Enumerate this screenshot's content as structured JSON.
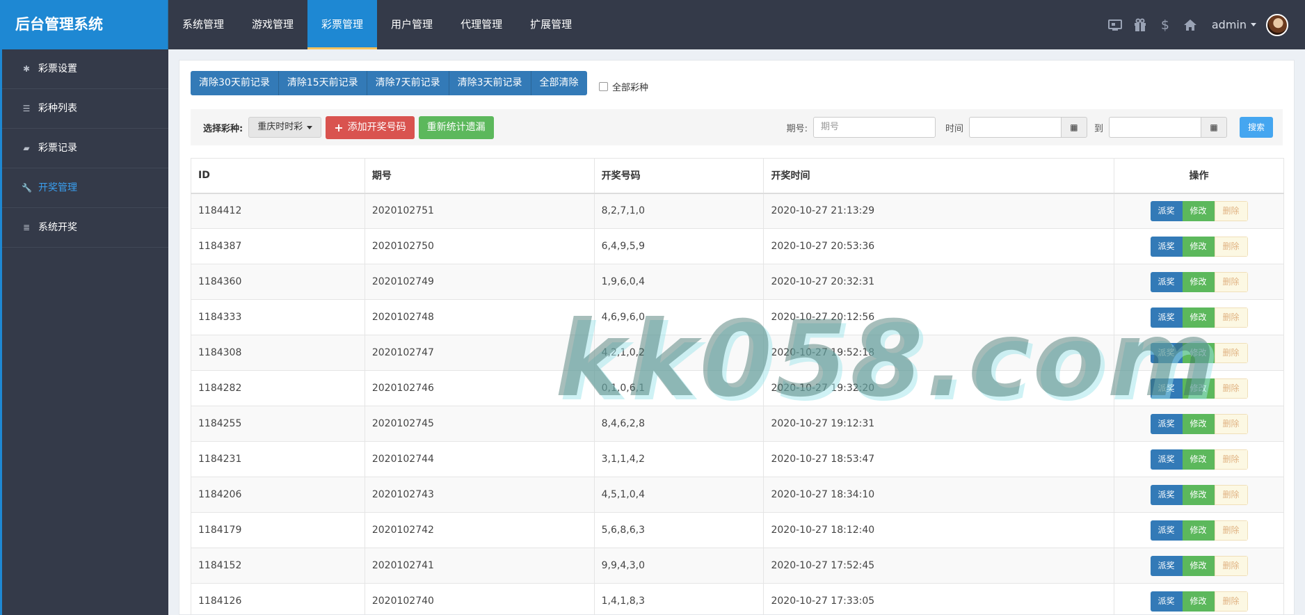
{
  "brand": {
    "title": "后台管理系统"
  },
  "topnav": {
    "items": [
      {
        "label": "系统管理",
        "active": false
      },
      {
        "label": "游戏管理",
        "active": false
      },
      {
        "label": "彩票管理",
        "active": true
      },
      {
        "label": "用户管理",
        "active": false
      },
      {
        "label": "代理管理",
        "active": false
      },
      {
        "label": "扩展管理",
        "active": false
      }
    ],
    "icons": [
      "monitor-icon",
      "gift-icon",
      "dollar-icon",
      "home-icon"
    ],
    "user": "admin"
  },
  "sidebar": {
    "items": [
      {
        "label": "彩票设置",
        "icon": "gear-icon",
        "active": false
      },
      {
        "label": "彩种列表",
        "icon": "list-icon",
        "active": false
      },
      {
        "label": "彩票记录",
        "icon": "book-icon",
        "active": false
      },
      {
        "label": "开奖管理",
        "icon": "wrench-icon",
        "active": true
      },
      {
        "label": "系统开奖",
        "icon": "server-icon",
        "active": false
      }
    ]
  },
  "clear_buttons": [
    "清除30天前记录",
    "清除15天前记录",
    "清除7天前记录",
    "清除3天前记录",
    "全部清除"
  ],
  "all_lottery_checkbox": "全部彩种",
  "filter": {
    "select_label": "选择彩种:",
    "select_value": "重庆时时彩",
    "add_button": "添加开奖号码",
    "recount_button": "重新统计遗漏",
    "issue_label": "期号:",
    "issue_placeholder": "期号",
    "time_label": "时间",
    "to_label": "到",
    "search_button": "搜索"
  },
  "table": {
    "headers": [
      "ID",
      "期号",
      "开奖号码",
      "开奖时间",
      "操作"
    ],
    "actions": {
      "pai": "派奖",
      "edit": "修改",
      "delete": "删除"
    },
    "rows": [
      [
        "1184412",
        "2020102751",
        "8,2,7,1,0",
        "2020-10-27 21:13:29"
      ],
      [
        "1184387",
        "2020102750",
        "6,4,9,5,9",
        "2020-10-27 20:53:36"
      ],
      [
        "1184360",
        "2020102749",
        "1,9,6,0,4",
        "2020-10-27 20:32:31"
      ],
      [
        "1184333",
        "2020102748",
        "4,6,9,6,0",
        "2020-10-27 20:12:56"
      ],
      [
        "1184308",
        "2020102747",
        "4,2,1,0,2",
        "2020-10-27 19:52:18"
      ],
      [
        "1184282",
        "2020102746",
        "0,1,0,6,1",
        "2020-10-27 19:32:20"
      ],
      [
        "1184255",
        "2020102745",
        "8,4,6,2,8",
        "2020-10-27 19:12:31"
      ],
      [
        "1184231",
        "2020102744",
        "3,1,1,4,2",
        "2020-10-27 18:53:47"
      ],
      [
        "1184206",
        "2020102743",
        "4,5,1,0,4",
        "2020-10-27 18:34:10"
      ],
      [
        "1184179",
        "2020102742",
        "5,6,8,6,3",
        "2020-10-27 18:12:40"
      ],
      [
        "1184152",
        "2020102741",
        "9,9,4,3,0",
        "2020-10-27 17:52:45"
      ],
      [
        "1184126",
        "2020102740",
        "1,4,1,8,3",
        "2020-10-27 17:33:05"
      ]
    ]
  },
  "watermark": "kk058.com"
}
